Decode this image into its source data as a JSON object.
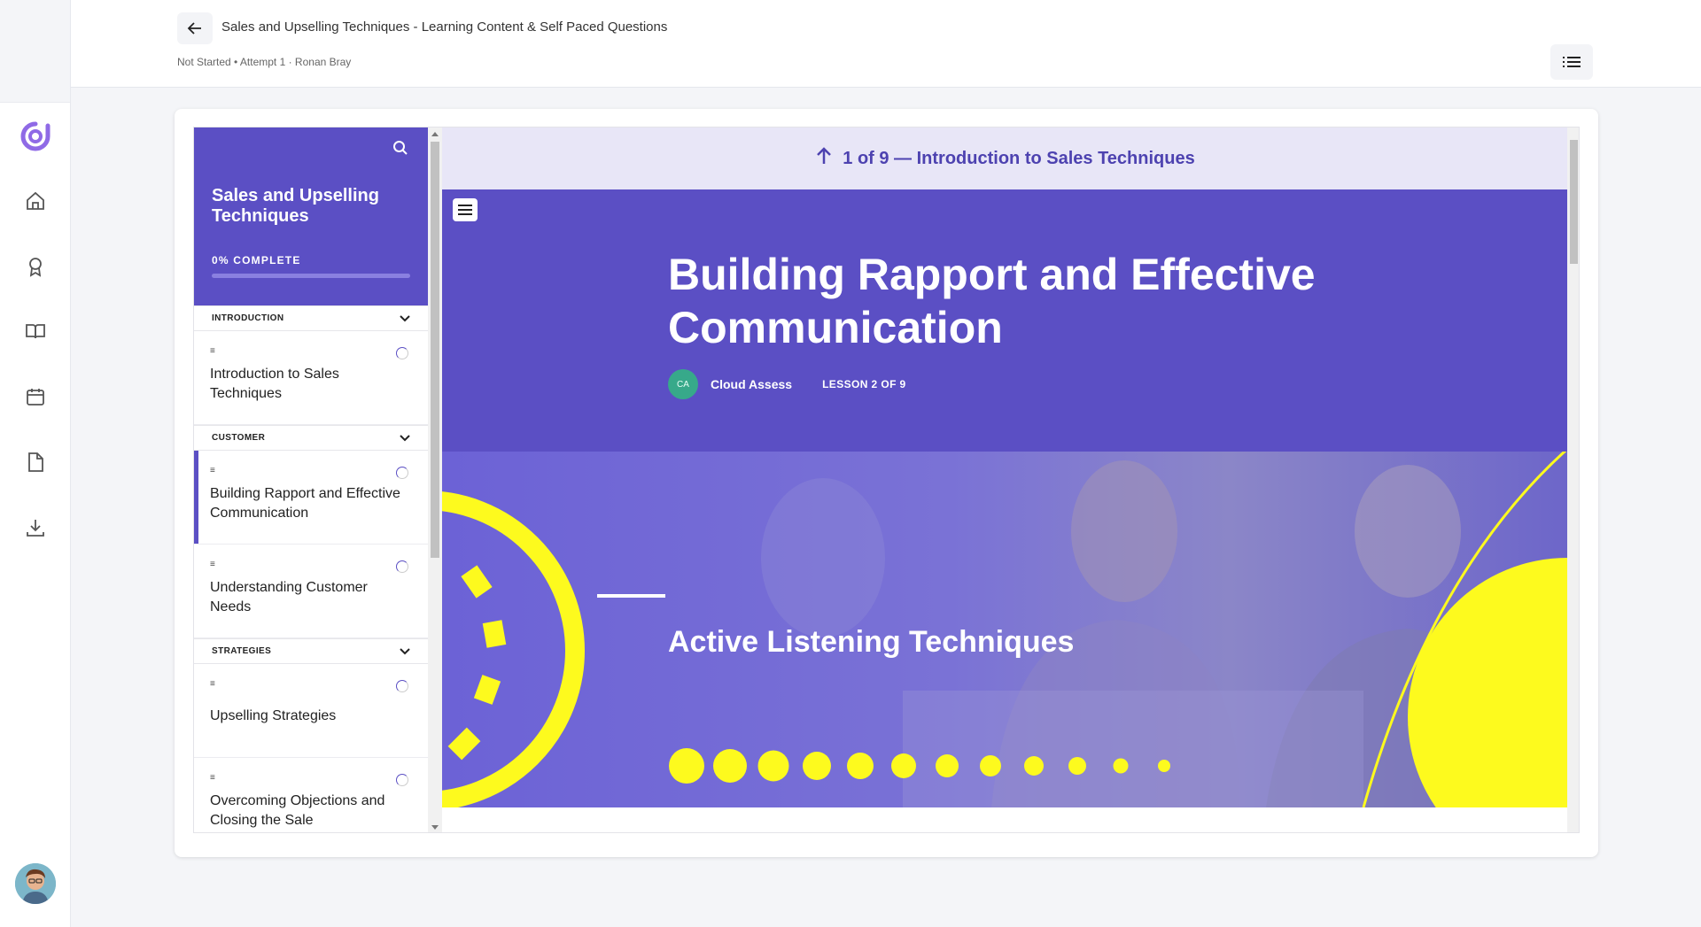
{
  "header": {
    "title": "Sales and Upselling Techniques - Learning Content & Self Paced Questions",
    "subtitle": "Not Started • Attempt 1 · Ronan Bray"
  },
  "rail": {
    "icons": [
      "logo-icon",
      "home-icon",
      "award-icon",
      "book-icon",
      "calendar-icon",
      "document-icon",
      "download-icon"
    ]
  },
  "course": {
    "title": "Sales and Upselling Techniques",
    "progress_label": "0% COMPLETE",
    "progress": 0
  },
  "sections": [
    {
      "label": "INTRODUCTION",
      "lessons": [
        {
          "title": "Introduction to Sales Techniques"
        }
      ]
    },
    {
      "label": "CUSTOMER",
      "lessons": [
        {
          "title": "Building Rapport and Effective Communication"
        },
        {
          "title": "Understanding Customer Needs"
        }
      ]
    },
    {
      "label": "STRATEGIES",
      "lessons": [
        {
          "title": "Upselling Strategies"
        },
        {
          "title": "Overcoming Objections and Closing the Sale"
        }
      ]
    }
  ],
  "content": {
    "prev_nav": "1 of 9 — Introduction to Sales Techniques",
    "lesson_title": "Building Rapport and Effective Communication",
    "author_initials": "CA",
    "author_name": "Cloud Assess",
    "lesson_position": "LESSON 2 OF 9",
    "banner_title": "Active Listening Techniques"
  },
  "colors": {
    "accent": "#5b4fc4",
    "highlight": "#fdfa1e"
  }
}
